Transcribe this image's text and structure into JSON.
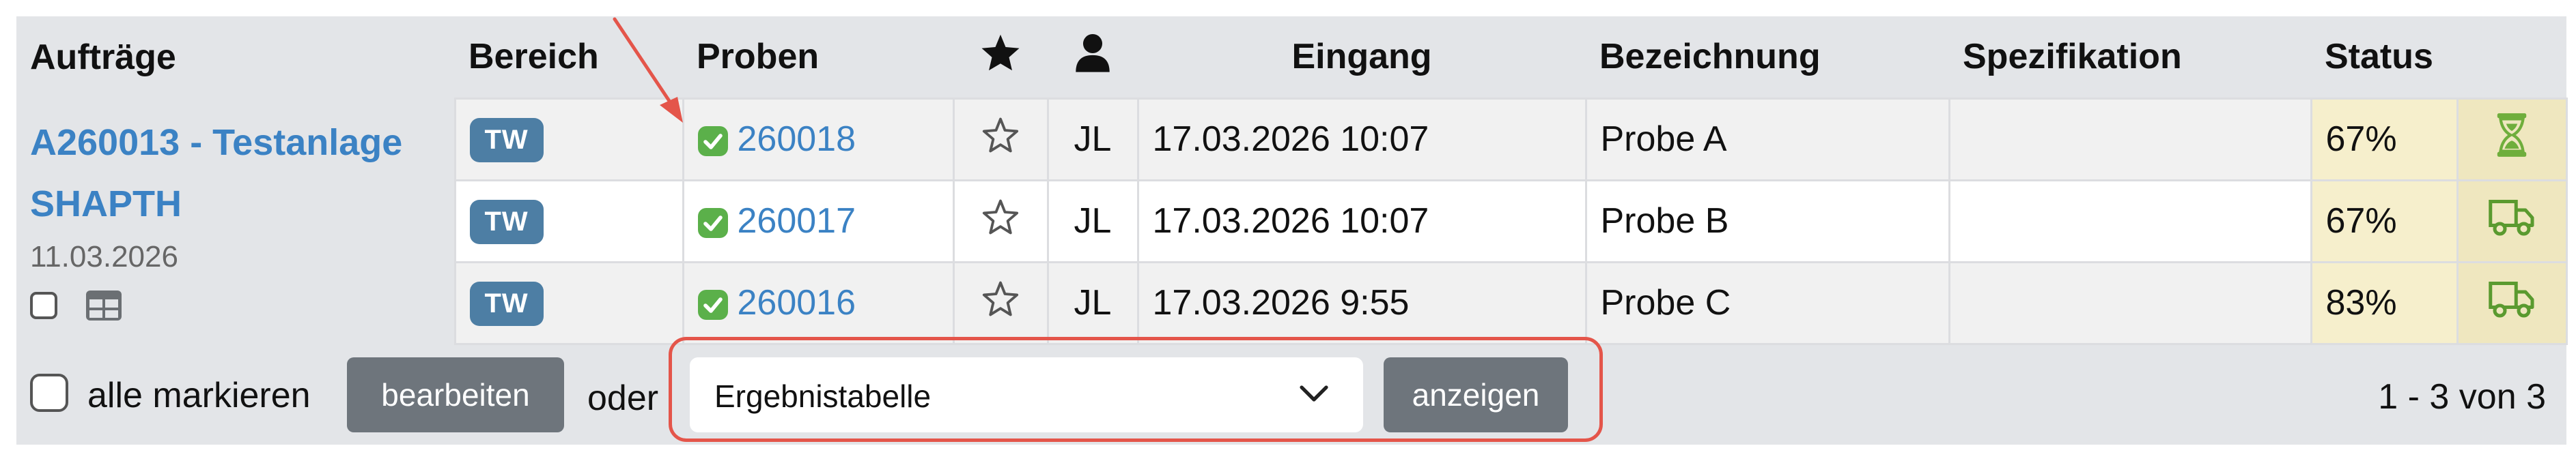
{
  "table": {
    "headers": {
      "auftraege": "Aufträge",
      "bereich": "Bereich",
      "proben": "Proben",
      "favorite_icon": "star-icon",
      "person_icon": "user-icon",
      "eingang": "Eingang",
      "bezeichnung": "Bezeichnung",
      "spezifikation": "Spezifikation",
      "status": "Status"
    },
    "order": {
      "line1": "A260013 - Testanlage",
      "line2": "SHAPTH",
      "date": "11.03.2026"
    },
    "rows": [
      {
        "bereich": "TW",
        "probe": "260018",
        "user": "JL",
        "eingang": "17.03.2026 10:07",
        "bezeichnung": "Probe A",
        "spezifikation": "",
        "status": "67%",
        "status_icon": "hourglass-icon"
      },
      {
        "bereich": "TW",
        "probe": "260017",
        "user": "JL",
        "eingang": "17.03.2026 10:07",
        "bezeichnung": "Probe B",
        "spezifikation": "",
        "status": "67%",
        "status_icon": "truck-icon"
      },
      {
        "bereich": "TW",
        "probe": "260016",
        "user": "JL",
        "eingang": "17.03.2026 9:55",
        "bezeichnung": "Probe C",
        "spezifikation": "",
        "status": "83%",
        "status_icon": "truck-icon"
      }
    ]
  },
  "footer": {
    "select_all_label": "alle markieren",
    "edit_button": "bearbeiten",
    "or_label": "oder",
    "view_select_value": "Ergebnistabelle",
    "show_button": "anzeigen",
    "pagination": "1 - 3 von 3"
  },
  "colors": {
    "link": "#3b82c4",
    "badge": "#4d7ea4",
    "ok_green": "#5bb04a",
    "status_bg": "#f6efcc",
    "annotation_red": "#e4554a"
  }
}
